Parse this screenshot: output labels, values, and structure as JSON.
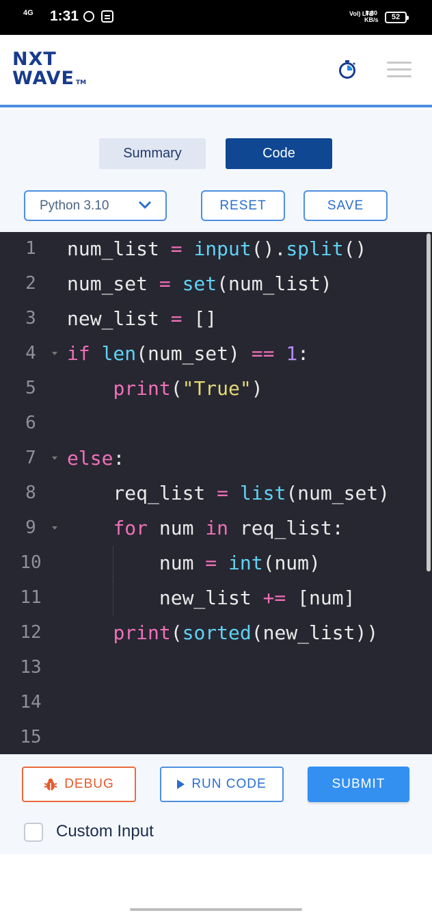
{
  "status_bar": {
    "network": "4G",
    "time": "1:31",
    "volte": "Vol) LTE",
    "speed": "8.80",
    "speed_unit": "KB/s",
    "battery": "52"
  },
  "header": {
    "logo_top": "NXT",
    "logo_bottom": "WAVE",
    "logo_tm": "TM"
  },
  "tabs": [
    {
      "label": "Summary",
      "active": false
    },
    {
      "label": "Code",
      "active": true
    }
  ],
  "toolbar": {
    "language": "Python 3.10",
    "reset_label": "RESET",
    "save_label": "SAVE"
  },
  "editor": {
    "line_numbers": [
      "1",
      "2",
      "3",
      "4",
      "5",
      "6",
      "7",
      "8",
      "9",
      "10",
      "11",
      "12",
      "13",
      "14",
      "15"
    ]
  },
  "actions": {
    "debug_label": "DEBUG",
    "run_label": "RUN CODE",
    "submit_label": "SUBMIT",
    "custom_input_label": "Custom Input"
  },
  "colors": {
    "brand_dark": "#0f4793",
    "accent": "#3390f0",
    "debug": "#e35a2b",
    "editor_bg": "#272731"
  }
}
